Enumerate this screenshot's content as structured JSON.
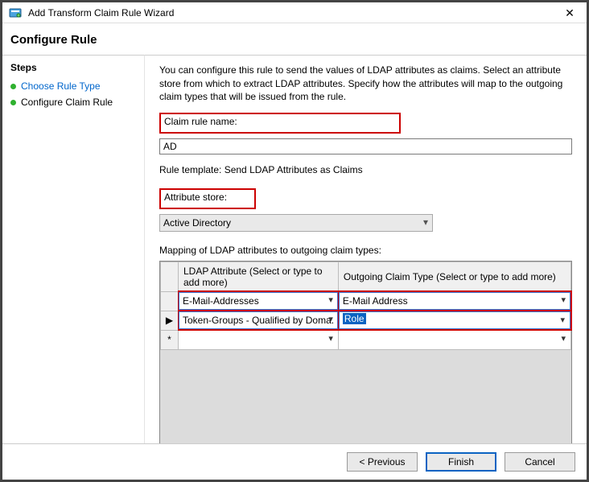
{
  "title": "Add Transform Claim Rule Wizard",
  "header": "Configure Rule",
  "steps": {
    "heading": "Steps",
    "items": [
      {
        "label": "Choose Rule Type",
        "current": false
      },
      {
        "label": "Configure Claim Rule",
        "current": true
      }
    ]
  },
  "desc": "You can configure this rule to send the values of LDAP attributes as claims. Select an attribute store from which to extract LDAP attributes. Specify how the attributes will map to the outgoing claim types that will be issued from the rule.",
  "claimRule": {
    "label": "Claim rule name:",
    "value": "AD"
  },
  "ruleTemplate": "Rule template: Send LDAP Attributes as Claims",
  "attrStore": {
    "label": "Attribute store:",
    "value": "Active Directory"
  },
  "mapping": {
    "heading": "Mapping of LDAP attributes to outgoing claim types:",
    "colA": "LDAP Attribute (Select or type to add more)",
    "colB": "Outgoing Claim Type (Select or type to add more)",
    "rows": [
      {
        "marker": "",
        "ldap": "E-Mail-Addresses",
        "claim": "E-Mail Address"
      },
      {
        "marker": "▶",
        "ldap": "Token-Groups - Qualified by Doma...",
        "claim": "Role"
      },
      {
        "marker": "*",
        "ldap": "",
        "claim": ""
      }
    ]
  },
  "buttons": {
    "prev": "< Previous",
    "finish": "Finish",
    "cancel": "Cancel"
  }
}
